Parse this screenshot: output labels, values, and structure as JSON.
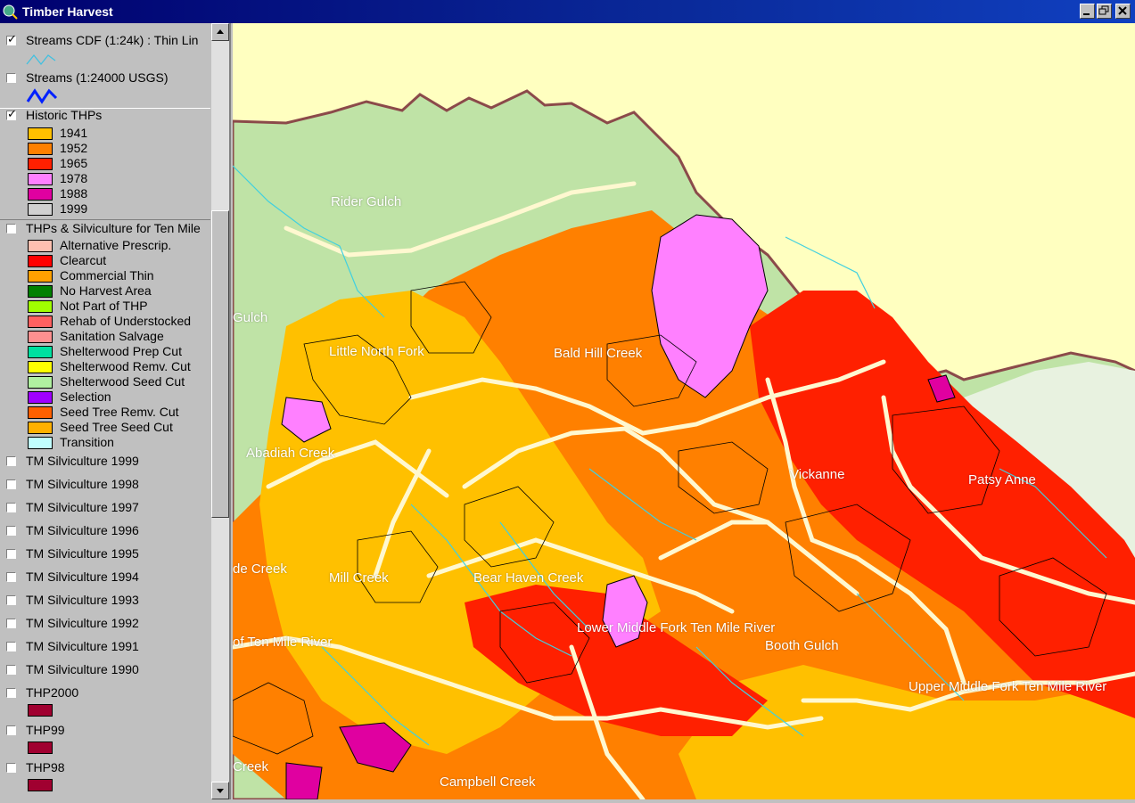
{
  "window": {
    "title": "Timber Harvest",
    "buttons": [
      "minimize",
      "restore",
      "close"
    ]
  },
  "toc": {
    "layers": [
      {
        "label": "Streams CDF (1:24k) : Thin Lin",
        "checked": true
      },
      {
        "label": "Streams (1:24000 USGS)",
        "checked": false
      },
      {
        "label": "Historic THPs",
        "checked": true
      },
      {
        "label": "THPs & Silviculture for Ten Mile",
        "checked": false
      },
      {
        "label": "TM Silviculture 1999",
        "checked": false
      },
      {
        "label": "TM Silviculture 1998",
        "checked": false
      },
      {
        "label": "TM Silviculture 1997",
        "checked": false
      },
      {
        "label": "TM Silviculture 1996",
        "checked": false
      },
      {
        "label": "TM Silviculture 1995",
        "checked": false
      },
      {
        "label": "TM Silviculture 1994",
        "checked": false
      },
      {
        "label": "TM Silviculture 1993",
        "checked": false
      },
      {
        "label": "TM Silviculture 1992",
        "checked": false
      },
      {
        "label": "TM Silviculture 1991",
        "checked": false
      },
      {
        "label": "TM Silviculture 1990",
        "checked": false
      },
      {
        "label": "THP2000",
        "checked": false
      },
      {
        "label": "THP99",
        "checked": false
      },
      {
        "label": "THP98",
        "checked": false
      }
    ],
    "historic_legend": [
      {
        "label": "1941",
        "color": "#ffc000"
      },
      {
        "label": "1952",
        "color": "#ff8000"
      },
      {
        "label": "1965",
        "color": "#ff2000"
      },
      {
        "label": "1978",
        "color": "#ff80ff"
      },
      {
        "label": "1988",
        "color": "#e000a0"
      },
      {
        "label": "1999",
        "color": "#d0d0d0"
      }
    ],
    "silviculture_legend": [
      {
        "label": "Alternative Prescrip.",
        "color": "#ffc0b0"
      },
      {
        "label": "Clearcut",
        "color": "#ff0000"
      },
      {
        "label": "Commercial Thin",
        "color": "#ffa000"
      },
      {
        "label": "No Harvest Area",
        "color": "#008000"
      },
      {
        "label": "Not Part of THP",
        "color": "#a0ff00"
      },
      {
        "label": "Rehab of Understocked",
        "color": "#ff6060"
      },
      {
        "label": "Sanitation Salvage",
        "color": "#ff9090"
      },
      {
        "label": "Shelterwood Prep Cut",
        "color": "#00e0a0"
      },
      {
        "label": "Shelterwood Remv. Cut",
        "color": "#ffff00"
      },
      {
        "label": "Shelterwood Seed Cut",
        "color": "#b0f0a0"
      },
      {
        "label": "Selection",
        "color": "#a000ff"
      },
      {
        "label": "Seed Tree Remv. Cut",
        "color": "#ff6000"
      },
      {
        "label": "Seed Tree Seed Cut",
        "color": "#ffb000"
      },
      {
        "label": "Transition",
        "color": "#c0ffff"
      }
    ],
    "thp_swatch_color": "#a00030"
  },
  "map": {
    "places": [
      "Rider Gulch",
      "Gulch",
      "Little North Fork",
      "Bald Hill Creek",
      "Abadiah Creek",
      "Vickanne",
      "Patsy Anne",
      "Mill Creek",
      "Bear Haven Creek",
      "Lower Middle Fork Ten Mile River",
      "Booth Gulch",
      "Upper Middle Fork Ten Mile River",
      "of Ten Mile River",
      "de Creek",
      "Campbell Creek",
      "Creek"
    ]
  }
}
